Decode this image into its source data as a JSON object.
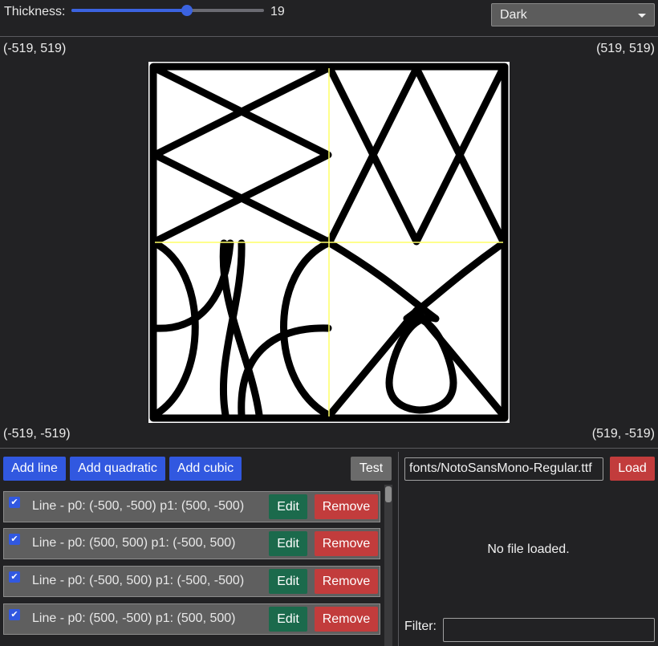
{
  "toolbar": {
    "thickness_label": "Thickness:",
    "thickness_value": "19",
    "thickness_fraction": 0.6,
    "theme_value": "Dark"
  },
  "canvas": {
    "top_left": "(-519, 519)",
    "top_right": "(519, 519)",
    "bottom_left": "(-519, -519)",
    "bottom_right": "(519, -519)",
    "axis_color": "#ffff66",
    "stroke_color": "#000000"
  },
  "actions": {
    "add_line": "Add line",
    "add_quadratic": "Add quadratic",
    "add_cubic": "Add cubic",
    "test": "Test"
  },
  "segments": [
    {
      "label": "Line - p0: (-500, -500) p1: (500, -500)",
      "edit": "Edit",
      "remove": "Remove"
    },
    {
      "label": "Line - p0: (500, 500) p1: (-500, 500)",
      "edit": "Edit",
      "remove": "Remove"
    },
    {
      "label": "Line - p0: (-500, 500) p1: (-500, -500)",
      "edit": "Edit",
      "remove": "Remove"
    },
    {
      "label": "Line - p0: (500, -500) p1: (500, 500)",
      "edit": "Edit",
      "remove": "Remove"
    }
  ],
  "font_panel": {
    "path": "fonts/NotoSansMono-Regular.ttf",
    "load": "Load",
    "status": "No file loaded.",
    "filter_label": "Filter:",
    "filter_value": ""
  },
  "colors": {
    "accent": "#3158e0",
    "edit": "#1b6a4c",
    "remove": "#c23c3c"
  }
}
